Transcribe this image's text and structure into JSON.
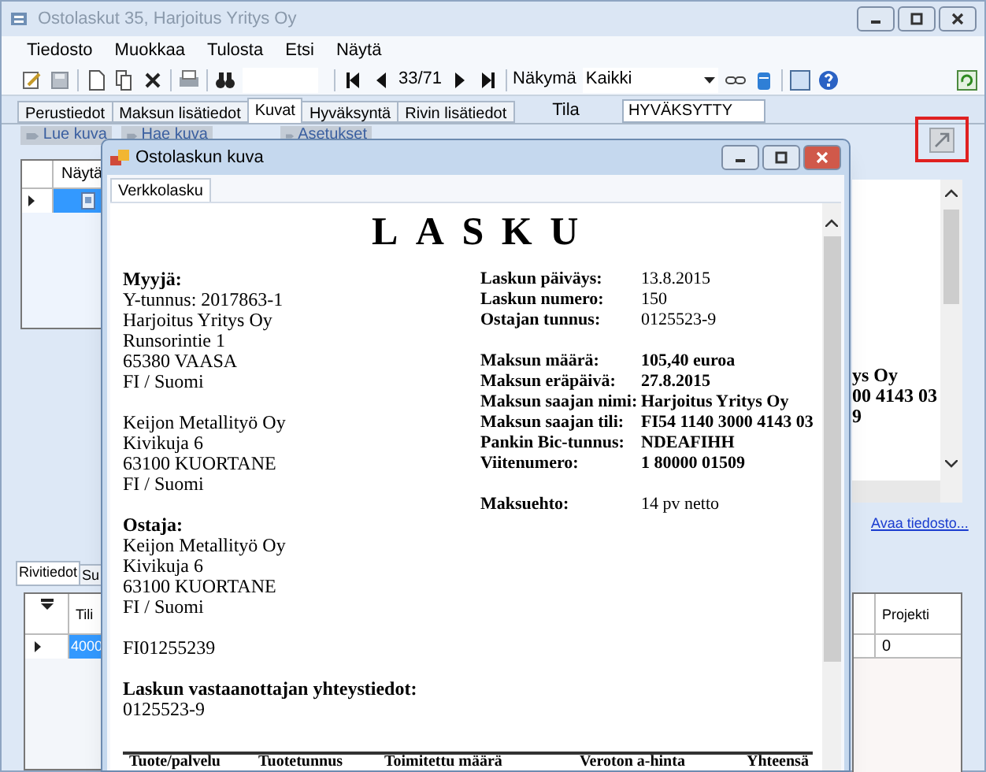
{
  "window": {
    "title": "Ostolaskut 35, Harjoitus Yritys Oy"
  },
  "menu": [
    "Tiedosto",
    "Muokkaa",
    "Tulosta",
    "Etsi",
    "Näytä"
  ],
  "toolbar": {
    "record": "33/71",
    "view_label": "Näkymä",
    "view": "Kaikki"
  },
  "tabs": [
    {
      "label": "Perustiedot",
      "selected": false
    },
    {
      "label": "Maksun lisätiedot",
      "selected": false
    },
    {
      "label": "Kuvat",
      "selected": true
    },
    {
      "label": "Hyväksyntä",
      "selected": false
    },
    {
      "label": "Rivin lisätiedot",
      "selected": false
    }
  ],
  "status": {
    "label": "Tila",
    "value": "HYVÄKSYTTY"
  },
  "image_buttons": [
    "Lue kuva",
    "Hae kuva",
    "Asetukset"
  ],
  "image_grid": {
    "column": "Näytä",
    "rows": [
      {
        "selected": true
      }
    ]
  },
  "detail_tabs": [
    {
      "label": "Rivitiedot",
      "selected": true
    },
    {
      "label": "Su",
      "selected": false
    }
  ],
  "lines_grid": {
    "columns": [
      "Tili",
      "Projekti"
    ],
    "rows": [
      {
        "cells": [
          "4000",
          "0"
        ],
        "selected": true
      }
    ]
  },
  "preview": {
    "fragments": [
      "ys Oy",
      "00 4143 03",
      "9"
    ],
    "link": "Avaa tiedosto..."
  },
  "dialog": {
    "title": "Ostolaskun kuva",
    "tabs": [
      {
        "label": "Verkkolasku",
        "selected": true
      }
    ],
    "invoice": {
      "heading": "LASKU",
      "left_blocks": [
        {
          "title": "Myyjä:",
          "lines": [
            "Y-tunnus: 2017863-1",
            "Harjoitus Yritys Oy",
            "Runsorintie 1",
            "65380 VAASA",
            "FI / Suomi"
          ]
        },
        {
          "lines": [
            "Keijon Metallityö Oy",
            "Kivikuja 6",
            "63100 KUORTANE",
            "FI / Suomi"
          ]
        },
        {
          "title": "Ostaja:",
          "lines": [
            "Keijon Metallityö Oy",
            "Kivikuja 6",
            "63100 KUORTANE",
            "FI / Suomi"
          ]
        },
        {
          "lines": [
            "FI01255239"
          ]
        },
        {
          "title": "Laskun vastaanottajan yhteystiedot:",
          "lines": [
            "0125523-9"
          ]
        }
      ],
      "right_groups": [
        {
          "emphasis": false,
          "fields": [
            {
              "label": "Laskun päiväys:",
              "value": "13.8.2015"
            },
            {
              "label": "Laskun numero:",
              "value": "150"
            },
            {
              "label": "Ostajan tunnus:",
              "value": "0125523-9"
            }
          ]
        },
        {
          "emphasis": true,
          "fields": [
            {
              "label": "Maksun määrä:",
              "value": "105,40 euroa"
            },
            {
              "label": "Maksun eräpäivä:",
              "value": "27.8.2015"
            },
            {
              "label": "Maksun saajan nimi:",
              "value": "Harjoitus Yritys Oy"
            },
            {
              "label": "Maksun saajan tili:",
              "value": "FI54 1140 3000 4143 03"
            },
            {
              "label": "Pankin Bic-tunnus:",
              "value": "NDEAFIHH"
            },
            {
              "label": "Viitenumero:",
              "value": "1 80000 01509"
            }
          ]
        },
        {
          "emphasis": false,
          "fields": [
            {
              "label": "Maksuehto:",
              "value": "14 pv netto"
            }
          ]
        }
      ],
      "table_columns": [
        "Tuote/palvelu",
        "Tuotetunnus",
        "Toimitettu määrä",
        "Veroton a-hinta",
        "Yhteensä"
      ]
    }
  }
}
